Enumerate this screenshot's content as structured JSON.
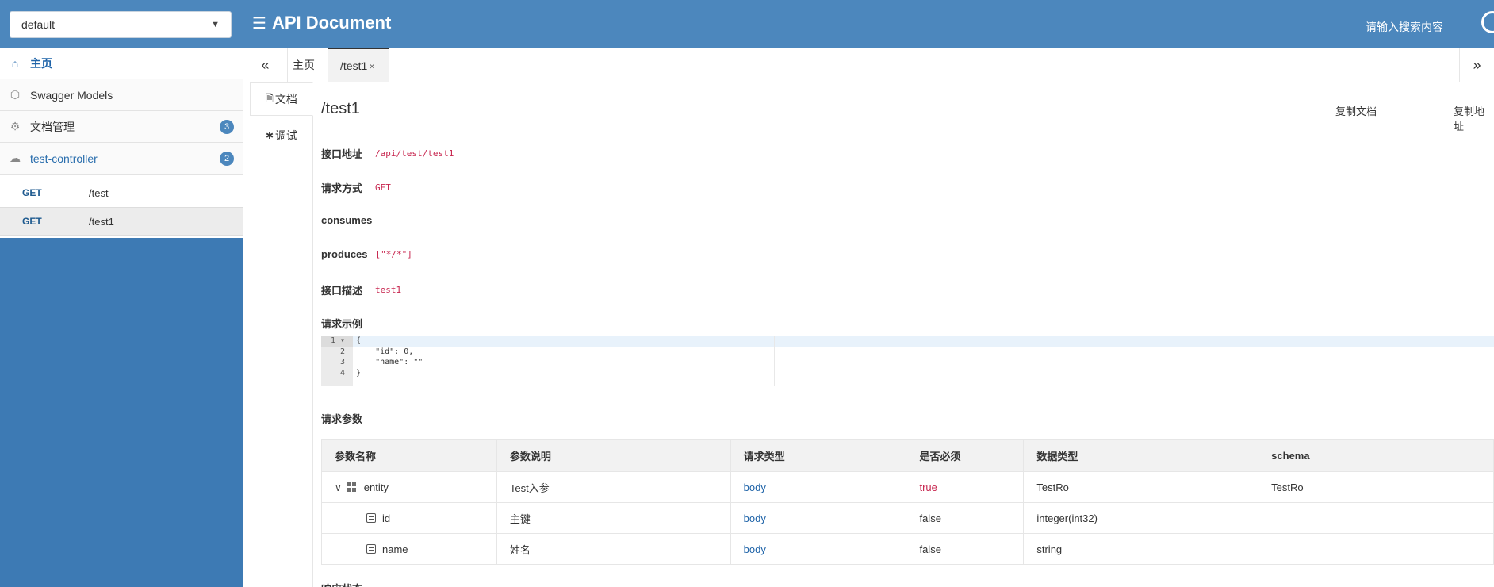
{
  "header": {
    "group_select": "default",
    "title": "API Document",
    "search_placeholder": "请输入搜索内容"
  },
  "sidebar": {
    "items": [
      {
        "label": "主页",
        "icon": "home-icon"
      },
      {
        "label": "Swagger Models",
        "icon": "cube-icon"
      },
      {
        "label": "文档管理",
        "icon": "settings-icon",
        "badge": "3"
      },
      {
        "label": "test-controller",
        "icon": "cloud-icon",
        "badge": "2"
      }
    ],
    "apis": [
      {
        "method": "GET",
        "path": "/test"
      },
      {
        "method": "GET",
        "path": "/test1"
      }
    ]
  },
  "tabs": {
    "prev": "«",
    "home": "主页",
    "current": "/test1",
    "close": "×",
    "next": "»"
  },
  "doc_tabs": {
    "doc": "文档",
    "debug": "调试"
  },
  "doc": {
    "title": "/test1",
    "copy_doc": "复制文档",
    "copy_address": "复制地址",
    "address_label": "接口地址",
    "address": "/api/test/test1",
    "method_label": "请求方式",
    "method": "GET",
    "consumes_label": "consumes",
    "produces_label": "produces",
    "produces": "[\"*/*\"]",
    "desc_label": "接口描述",
    "desc": "test1",
    "example_label": "请求示例",
    "example_lines": [
      "{",
      "    \"id\": 0,",
      "    \"name\": \"\"",
      "}"
    ],
    "params_label": "请求参数",
    "response_label": "响应状态"
  },
  "params_table": {
    "headers": [
      "参数名称",
      "参数说明",
      "请求类型",
      "是否必须",
      "数据类型",
      "schema"
    ],
    "rows": [
      {
        "name": "entity",
        "desc": "Test入参",
        "in": "body",
        "required": "true",
        "type": "TestRo",
        "schema": "TestRo"
      },
      {
        "name": "id",
        "desc": "主键",
        "in": "body",
        "required": "false",
        "type": "integer(int32)",
        "schema": ""
      },
      {
        "name": "name",
        "desc": "姓名",
        "in": "body",
        "required": "false",
        "type": "string",
        "schema": ""
      }
    ]
  },
  "colors": {
    "header_bg": "#4c87bd",
    "sidebar_bg": "#3d7ab4",
    "accent_red": "#c7254e",
    "link_blue": "#1e63a8"
  }
}
